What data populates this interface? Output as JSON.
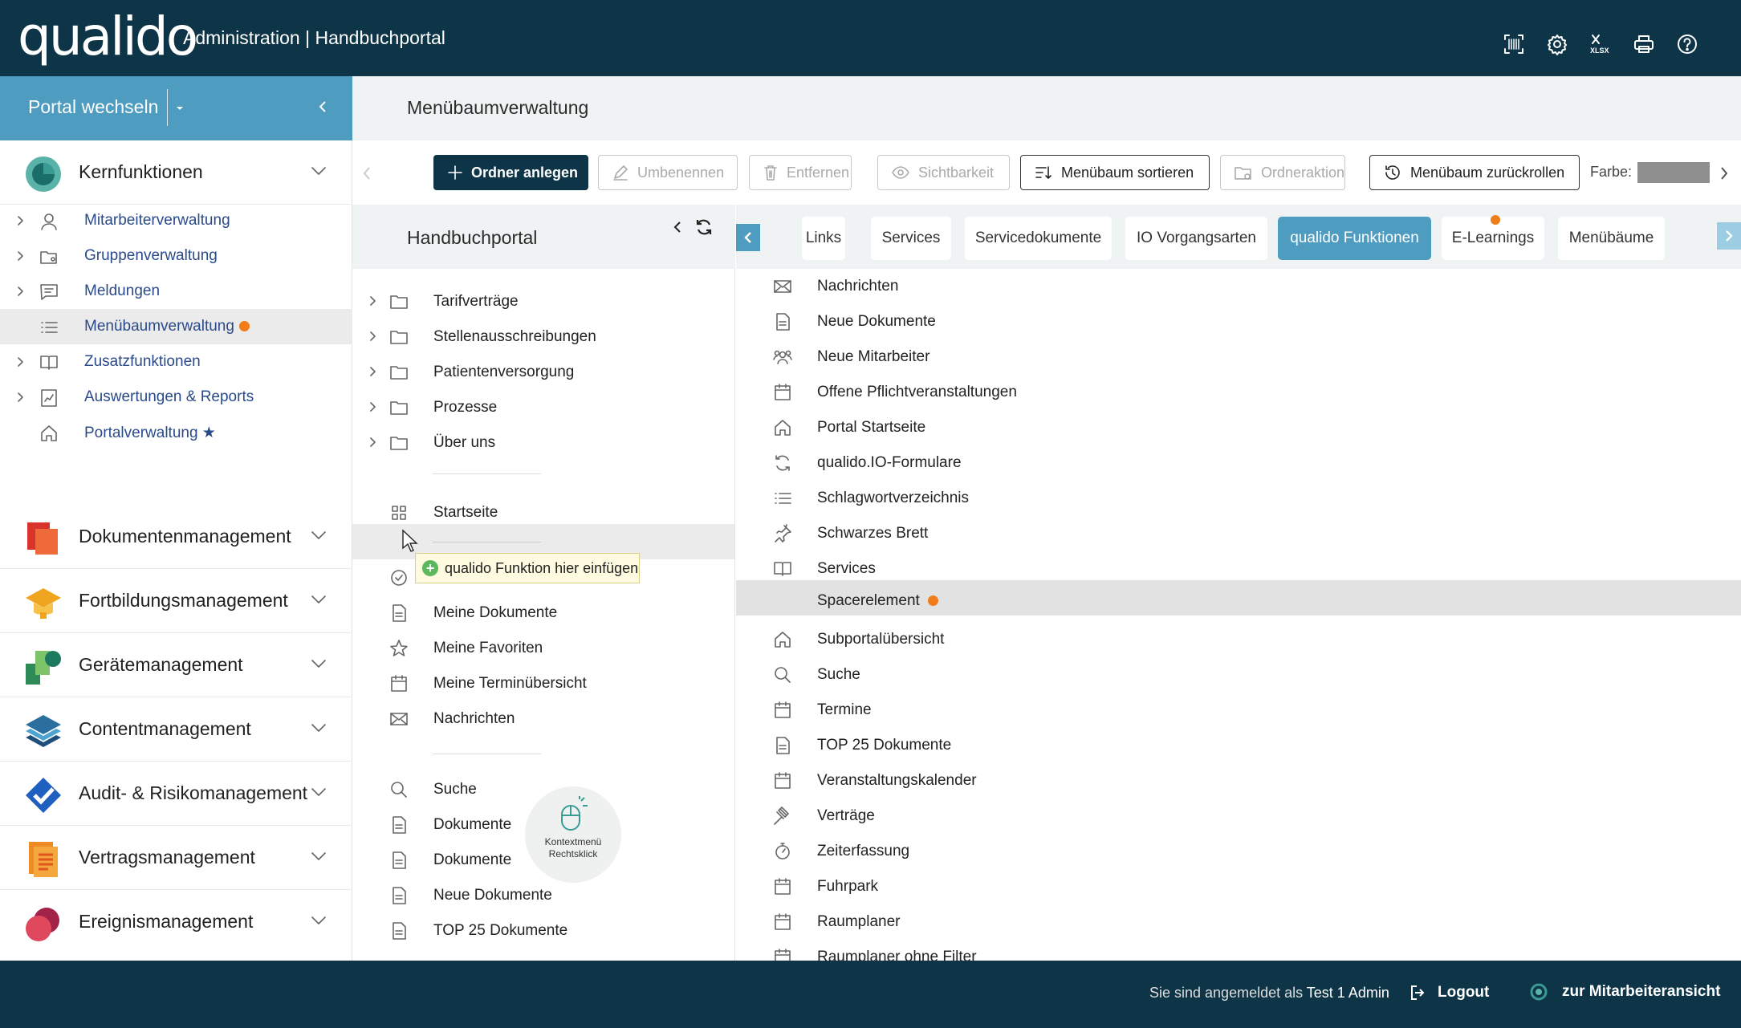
{
  "header": {
    "logo": "qualido",
    "title": "Administration | Handbuchportal",
    "icons": [
      "barcode-icon",
      "settings-icon",
      "xlsx-export-icon",
      "print-icon",
      "help-icon"
    ]
  },
  "portal": {
    "label": "Portal wechseln"
  },
  "page_title": "Menübaumverwaltung",
  "sidebar": {
    "kern": "Kernfunktionen",
    "items": [
      {
        "label": "Mitarbeiterverwaltung",
        "icon": "user-icon"
      },
      {
        "label": "Gruppenverwaltung",
        "icon": "group-folder-icon"
      },
      {
        "label": "Meldungen",
        "icon": "message-icon"
      },
      {
        "label": "Menübaumverwaltung",
        "icon": "list-icon",
        "active": true
      },
      {
        "label": "Zusatzfunktionen",
        "icon": "book-icon"
      },
      {
        "label": "Auswertungen & Reports",
        "icon": "report-icon"
      },
      {
        "label": "Portalverwaltung ★",
        "icon": "home-icon"
      }
    ],
    "modules": [
      "Dokumentenmanagement",
      "Fortbildungsmanagement",
      "Gerätemanagement",
      "Contentmanagement",
      "Audit- & Risikomanagement",
      "Vertragsmanagement",
      "Ereignismanagement"
    ]
  },
  "toolbar": {
    "ordner_anlegen": "Ordner anlegen",
    "umbenennen": "Umbenennen",
    "entfernen": "Entfernen",
    "sichtbarkeit": "Sichtbarkeit",
    "sortieren": "Menübaum sortieren",
    "ordneraktion": "Ordneraktion",
    "zurueckrollen": "Menübaum zurückrollen",
    "farbe": "Farbe:",
    "farbe_color": "#8f8f8f"
  },
  "tree": {
    "title": "Handbuchportal",
    "folders": [
      "Tarifverträge",
      "Stellenausschreibungen",
      "Patientenversorgung",
      "Prozesse",
      "Über uns"
    ],
    "startseite": "Startseite",
    "tooltip": "qualido Funktion hier einfügen",
    "items1": [
      "Meine Dokumente",
      "Meine Favoriten",
      "Meine Terminübersicht",
      "Nachrichten"
    ],
    "items2": [
      "Suche",
      "Dokumente",
      "Dokumente",
      "Neue Dokumente",
      "TOP 25 Dokumente"
    ],
    "ctx_hint": [
      "Kontextmenü",
      "Rechtsklick"
    ]
  },
  "tabs": [
    "Links",
    "Services",
    "Servicedokumente",
    "IO Vorgangsarten",
    "qualido Funktionen",
    "E-Learnings",
    "Menübäume"
  ],
  "selected_tab": "qualido Funktionen",
  "functions": [
    "Nachrichten",
    "Neue Dokumente",
    "Neue Mitarbeiter",
    "Offene Pflichtveranstaltungen",
    "Portal Startseite",
    "qualido.IO-Formulare",
    "Schlagwortverzeichnis",
    "Schwarzes Brett",
    "Services",
    "Spacerelement",
    "Subportalübersicht",
    "Suche",
    "Termine",
    "TOP 25 Dokumente",
    "Veranstaltungskalender",
    "Verträge",
    "Zeiterfassung",
    "Fuhrpark",
    "Raumplaner",
    "Raumplaner ohne Filter"
  ],
  "footer": {
    "logged_in_prefix": "Sie sind angemeldet als ",
    "user": "Test 1 Admin",
    "logout": "Logout",
    "mitarbeiteransicht": "zur Mitarbeiteransicht"
  },
  "colors": {
    "header": "#0d3547",
    "accent": "#4f9cc1",
    "orange": "#f07d1a",
    "panel": "#eff3f4"
  }
}
